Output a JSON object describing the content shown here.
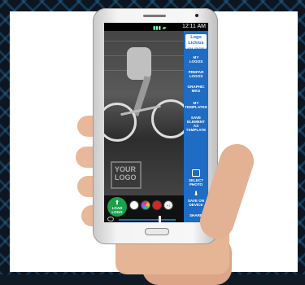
{
  "status": {
    "time": "12:11 AM"
  },
  "brand": {
    "name_line1": "Logo",
    "name_line2": "Lichius",
    "tagline": "a.k.a. you-logo"
  },
  "sidebar": {
    "items": [
      {
        "label": "MY\nLOGOS"
      },
      {
        "label": "PREPAR\nLOGOS"
      },
      {
        "label": "GRAPHIC\nMKG"
      },
      {
        "label": "MY\nTEMPLATES"
      },
      {
        "label": "SAVE\nELEMENT\nAS\nTEMPLATE"
      },
      {
        "label": "SELECT\nPHOTO"
      },
      {
        "label": "SAVE ON\nDEVICE"
      },
      {
        "label": "SHARE"
      }
    ]
  },
  "placeholder_logo": {
    "line1": "YOUR",
    "line2": "LOGO"
  },
  "toolbar": {
    "load_logo": "LOAD\nLOGO",
    "tool4": "+ /"
  },
  "slider": {
    "value": 0.72
  }
}
